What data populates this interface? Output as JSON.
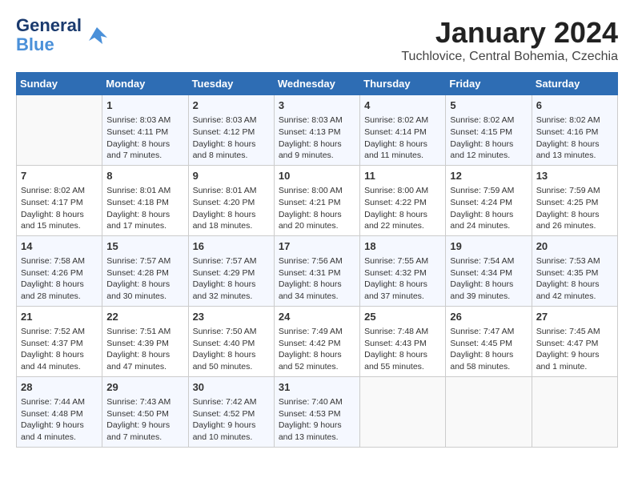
{
  "header": {
    "logo_line1": "General",
    "logo_line2": "Blue",
    "month_year": "January 2024",
    "location": "Tuchlovice, Central Bohemia, Czechia"
  },
  "weekdays": [
    "Sunday",
    "Monday",
    "Tuesday",
    "Wednesday",
    "Thursday",
    "Friday",
    "Saturday"
  ],
  "weeks": [
    [
      {
        "day": "",
        "info": ""
      },
      {
        "day": "1",
        "info": "Sunrise: 8:03 AM\nSunset: 4:11 PM\nDaylight: 8 hours\nand 7 minutes."
      },
      {
        "day": "2",
        "info": "Sunrise: 8:03 AM\nSunset: 4:12 PM\nDaylight: 8 hours\nand 8 minutes."
      },
      {
        "day": "3",
        "info": "Sunrise: 8:03 AM\nSunset: 4:13 PM\nDaylight: 8 hours\nand 9 minutes."
      },
      {
        "day": "4",
        "info": "Sunrise: 8:02 AM\nSunset: 4:14 PM\nDaylight: 8 hours\nand 11 minutes."
      },
      {
        "day": "5",
        "info": "Sunrise: 8:02 AM\nSunset: 4:15 PM\nDaylight: 8 hours\nand 12 minutes."
      },
      {
        "day": "6",
        "info": "Sunrise: 8:02 AM\nSunset: 4:16 PM\nDaylight: 8 hours\nand 13 minutes."
      }
    ],
    [
      {
        "day": "7",
        "info": "Sunrise: 8:02 AM\nSunset: 4:17 PM\nDaylight: 8 hours\nand 15 minutes."
      },
      {
        "day": "8",
        "info": "Sunrise: 8:01 AM\nSunset: 4:18 PM\nDaylight: 8 hours\nand 17 minutes."
      },
      {
        "day": "9",
        "info": "Sunrise: 8:01 AM\nSunset: 4:20 PM\nDaylight: 8 hours\nand 18 minutes."
      },
      {
        "day": "10",
        "info": "Sunrise: 8:00 AM\nSunset: 4:21 PM\nDaylight: 8 hours\nand 20 minutes."
      },
      {
        "day": "11",
        "info": "Sunrise: 8:00 AM\nSunset: 4:22 PM\nDaylight: 8 hours\nand 22 minutes."
      },
      {
        "day": "12",
        "info": "Sunrise: 7:59 AM\nSunset: 4:24 PM\nDaylight: 8 hours\nand 24 minutes."
      },
      {
        "day": "13",
        "info": "Sunrise: 7:59 AM\nSunset: 4:25 PM\nDaylight: 8 hours\nand 26 minutes."
      }
    ],
    [
      {
        "day": "14",
        "info": "Sunrise: 7:58 AM\nSunset: 4:26 PM\nDaylight: 8 hours\nand 28 minutes."
      },
      {
        "day": "15",
        "info": "Sunrise: 7:57 AM\nSunset: 4:28 PM\nDaylight: 8 hours\nand 30 minutes."
      },
      {
        "day": "16",
        "info": "Sunrise: 7:57 AM\nSunset: 4:29 PM\nDaylight: 8 hours\nand 32 minutes."
      },
      {
        "day": "17",
        "info": "Sunrise: 7:56 AM\nSunset: 4:31 PM\nDaylight: 8 hours\nand 34 minutes."
      },
      {
        "day": "18",
        "info": "Sunrise: 7:55 AM\nSunset: 4:32 PM\nDaylight: 8 hours\nand 37 minutes."
      },
      {
        "day": "19",
        "info": "Sunrise: 7:54 AM\nSunset: 4:34 PM\nDaylight: 8 hours\nand 39 minutes."
      },
      {
        "day": "20",
        "info": "Sunrise: 7:53 AM\nSunset: 4:35 PM\nDaylight: 8 hours\nand 42 minutes."
      }
    ],
    [
      {
        "day": "21",
        "info": "Sunrise: 7:52 AM\nSunset: 4:37 PM\nDaylight: 8 hours\nand 44 minutes."
      },
      {
        "day": "22",
        "info": "Sunrise: 7:51 AM\nSunset: 4:39 PM\nDaylight: 8 hours\nand 47 minutes."
      },
      {
        "day": "23",
        "info": "Sunrise: 7:50 AM\nSunset: 4:40 PM\nDaylight: 8 hours\nand 50 minutes."
      },
      {
        "day": "24",
        "info": "Sunrise: 7:49 AM\nSunset: 4:42 PM\nDaylight: 8 hours\nand 52 minutes."
      },
      {
        "day": "25",
        "info": "Sunrise: 7:48 AM\nSunset: 4:43 PM\nDaylight: 8 hours\nand 55 minutes."
      },
      {
        "day": "26",
        "info": "Sunrise: 7:47 AM\nSunset: 4:45 PM\nDaylight: 8 hours\nand 58 minutes."
      },
      {
        "day": "27",
        "info": "Sunrise: 7:45 AM\nSunset: 4:47 PM\nDaylight: 9 hours\nand 1 minute."
      }
    ],
    [
      {
        "day": "28",
        "info": "Sunrise: 7:44 AM\nSunset: 4:48 PM\nDaylight: 9 hours\nand 4 minutes."
      },
      {
        "day": "29",
        "info": "Sunrise: 7:43 AM\nSunset: 4:50 PM\nDaylight: 9 hours\nand 7 minutes."
      },
      {
        "day": "30",
        "info": "Sunrise: 7:42 AM\nSunset: 4:52 PM\nDaylight: 9 hours\nand 10 minutes."
      },
      {
        "day": "31",
        "info": "Sunrise: 7:40 AM\nSunset: 4:53 PM\nDaylight: 9 hours\nand 13 minutes."
      },
      {
        "day": "",
        "info": ""
      },
      {
        "day": "",
        "info": ""
      },
      {
        "day": "",
        "info": ""
      }
    ]
  ]
}
